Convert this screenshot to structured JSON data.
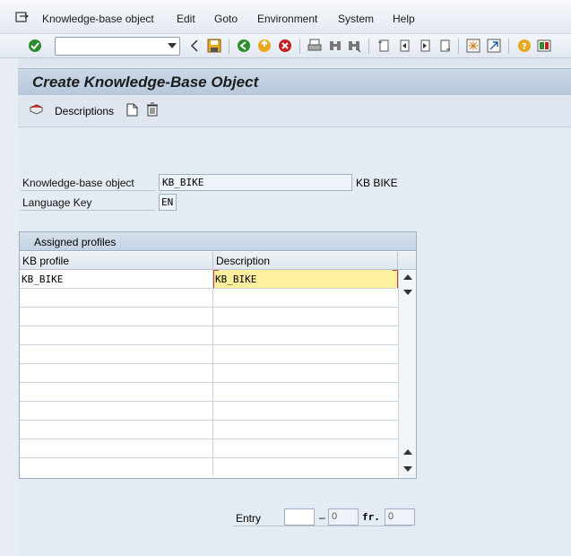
{
  "menu": {
    "items": [
      {
        "label": "Knowledge-base object"
      },
      {
        "label": "Edit"
      },
      {
        "label": "Goto"
      },
      {
        "label": "Environment"
      },
      {
        "label": "System"
      },
      {
        "label": "Help"
      }
    ]
  },
  "toolbar": {
    "command_value": ""
  },
  "title": "Create Knowledge-Base Object",
  "app_toolbar": {
    "descriptions_label": "Descriptions"
  },
  "form": {
    "kb_object_label": "Knowledge-base object",
    "kb_object_value": "KB_BIKE",
    "kb_object_desc": "KB BIKE",
    "language_label": "Language Key",
    "language_value": "EN"
  },
  "table": {
    "title": "Assigned profiles",
    "columns": [
      "KB profile",
      "Description"
    ],
    "rows": [
      {
        "profile": "KB_BIKE",
        "description": "KB_BIKE"
      }
    ]
  },
  "entry": {
    "label": "Entry",
    "value": "",
    "dash": "–",
    "from": "0",
    "fr_label": "fr.",
    "total": "0"
  },
  "colors": {
    "title_band": "#bfcfe1",
    "active_cell": "#fff0a0",
    "active_border": "#c04040"
  }
}
